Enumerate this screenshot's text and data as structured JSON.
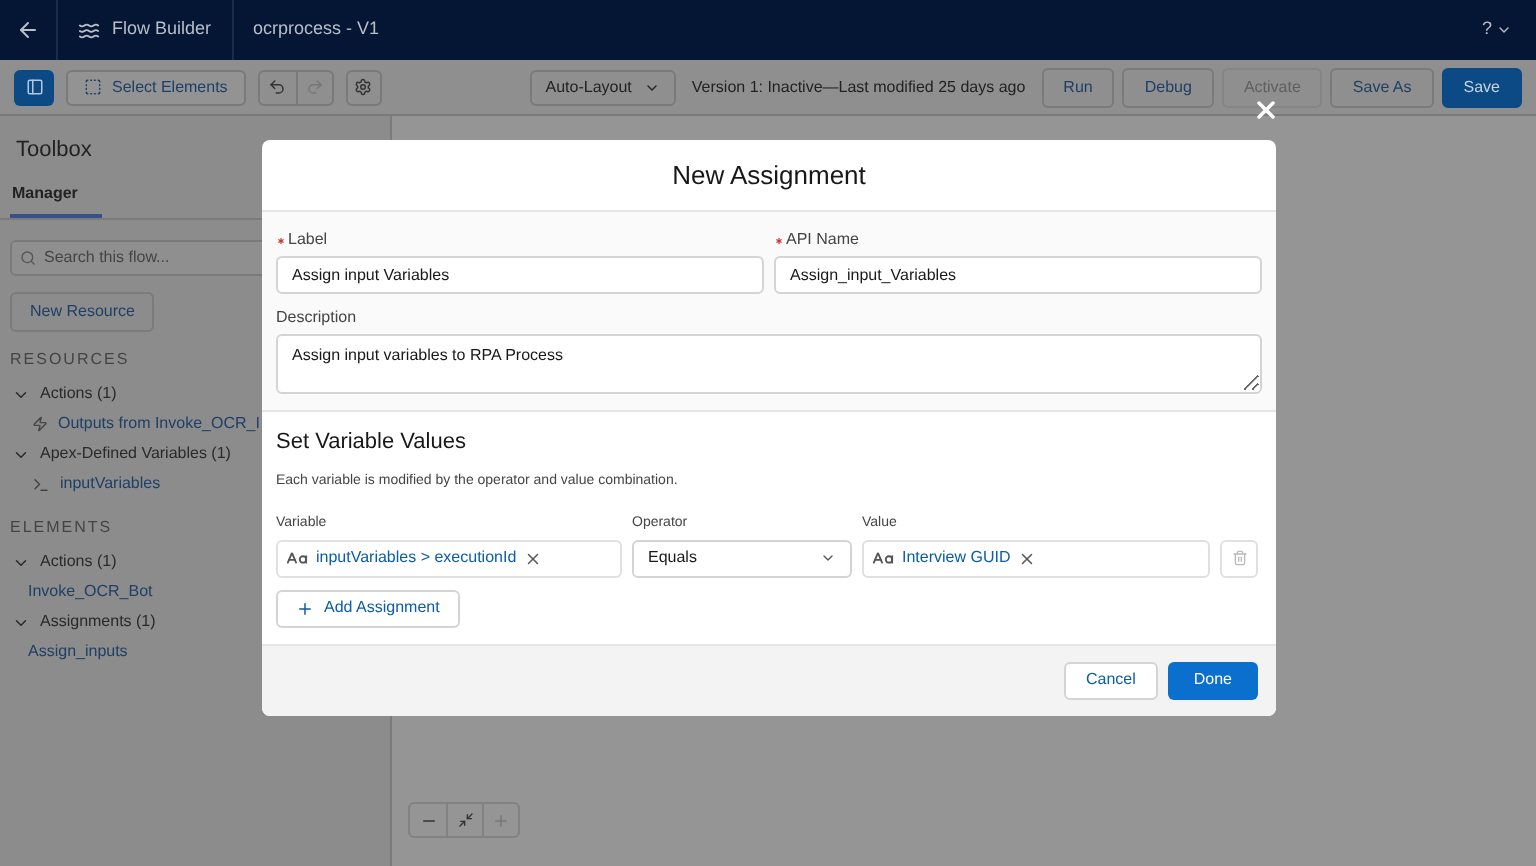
{
  "header": {
    "app_name": "Flow Builder",
    "flow_name": "ocrprocess - V1",
    "help": "?"
  },
  "toolbar": {
    "select_elements": "Select Elements",
    "layout": "Auto-Layout",
    "version": "Version 1: Inactive—Last modified 25 days ago",
    "buttons": [
      {
        "label": "Run",
        "kind": "neutral",
        "disabled": false
      },
      {
        "label": "Debug",
        "kind": "neutral",
        "disabled": false
      },
      {
        "label": "Activate",
        "kind": "neutral",
        "disabled": true
      },
      {
        "label": "Save As",
        "kind": "neutral",
        "disabled": false
      },
      {
        "label": "Save",
        "kind": "brand",
        "disabled": false
      }
    ]
  },
  "toolbox": {
    "title": "Toolbox",
    "tabs": [
      {
        "label": "Manager",
        "selected": true
      }
    ],
    "search": {
      "placeholder": "Search this flow..."
    },
    "new_resource": "New Resource",
    "sections": [
      {
        "heading": "RESOURCES",
        "groups": [
          {
            "label": "Actions (1)",
            "expanded": true,
            "children": [
              {
                "label": "Outputs from Invoke_OCR_I",
                "kind": "action"
              }
            ]
          },
          {
            "label": "Apex-Defined Variables (1)",
            "expanded": true,
            "children": [
              {
                "label": "inputVariables",
                "kind": "variable"
              }
            ]
          }
        ]
      },
      {
        "heading": "ELEMENTS",
        "groups": [
          {
            "label": "Actions (1)",
            "expanded": true,
            "children": [
              {
                "label": "Invoke_OCR_Bot",
                "kind": "element"
              }
            ]
          },
          {
            "label": "Assignments (1)",
            "expanded": true,
            "children": [
              {
                "label": "Assign_inputs",
                "kind": "element"
              }
            ]
          }
        ]
      }
    ]
  },
  "modal": {
    "title": "New Assignment",
    "label": {
      "label": "Label",
      "required": true,
      "value": "Assign input Variables"
    },
    "api_name": {
      "label": "API Name",
      "required": true,
      "value": "Assign_input_Variables"
    },
    "description": {
      "label": "Description",
      "value": "Assign input variables to RPA Process"
    },
    "section_title": "Set Variable Values",
    "section_help": "Each variable is modified by the operator and value combination.",
    "columns": [
      "Variable",
      "Operator",
      "Value"
    ],
    "rows": [
      {
        "variable": "inputVariables > executionId",
        "operator": "Equals",
        "value": "Interview GUID"
      }
    ],
    "add_assignment": "Add Assignment",
    "cancel": "Cancel",
    "done": "Done"
  }
}
